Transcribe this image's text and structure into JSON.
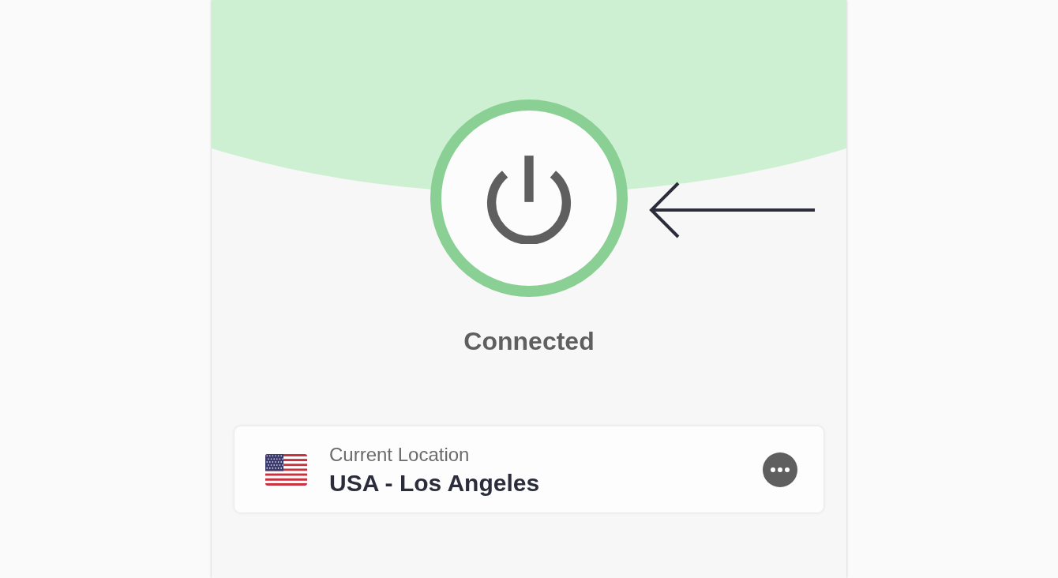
{
  "power_button": {
    "connected": true
  },
  "status": "Connected",
  "location": {
    "label": "Current Location",
    "name": "USA - Los Angeles"
  }
}
